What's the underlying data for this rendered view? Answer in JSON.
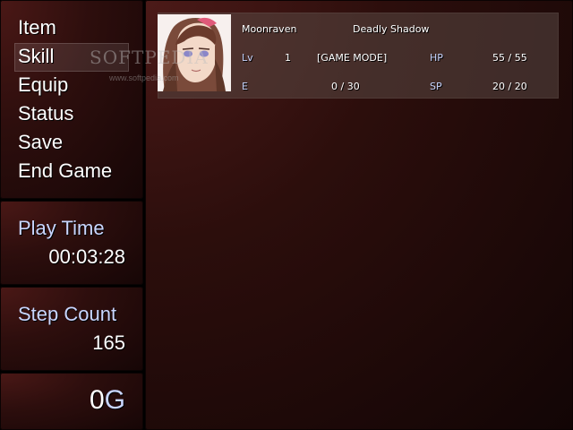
{
  "menu": {
    "items": [
      "Item",
      "Skill",
      "Equip",
      "Status",
      "Save",
      "End Game"
    ],
    "selected": "Skill"
  },
  "play_time": {
    "label": "Play Time",
    "value": "00:03:28"
  },
  "step_count": {
    "label": "Step Count",
    "value": "165"
  },
  "gold": {
    "amount": "0",
    "unit": "G"
  },
  "actor": {
    "name": "Moonraven",
    "class": "Deadly Shadow",
    "level_label": "Lv",
    "level": "1",
    "state": "[GAME MODE]",
    "hp_label": "HP",
    "hp": "55 / 55",
    "exp_label": "E",
    "exp": "0 / 30",
    "sp_label": "SP",
    "sp": "20 / 20",
    "portrait_icon": "character-portrait"
  },
  "watermark": {
    "text": "SOFTPEDIA",
    "url": "www.softpedia.com"
  },
  "colors": {
    "window_red": "#2d0e0d",
    "system_text": "#c9d6ff",
    "highlight": "#5a4844"
  }
}
